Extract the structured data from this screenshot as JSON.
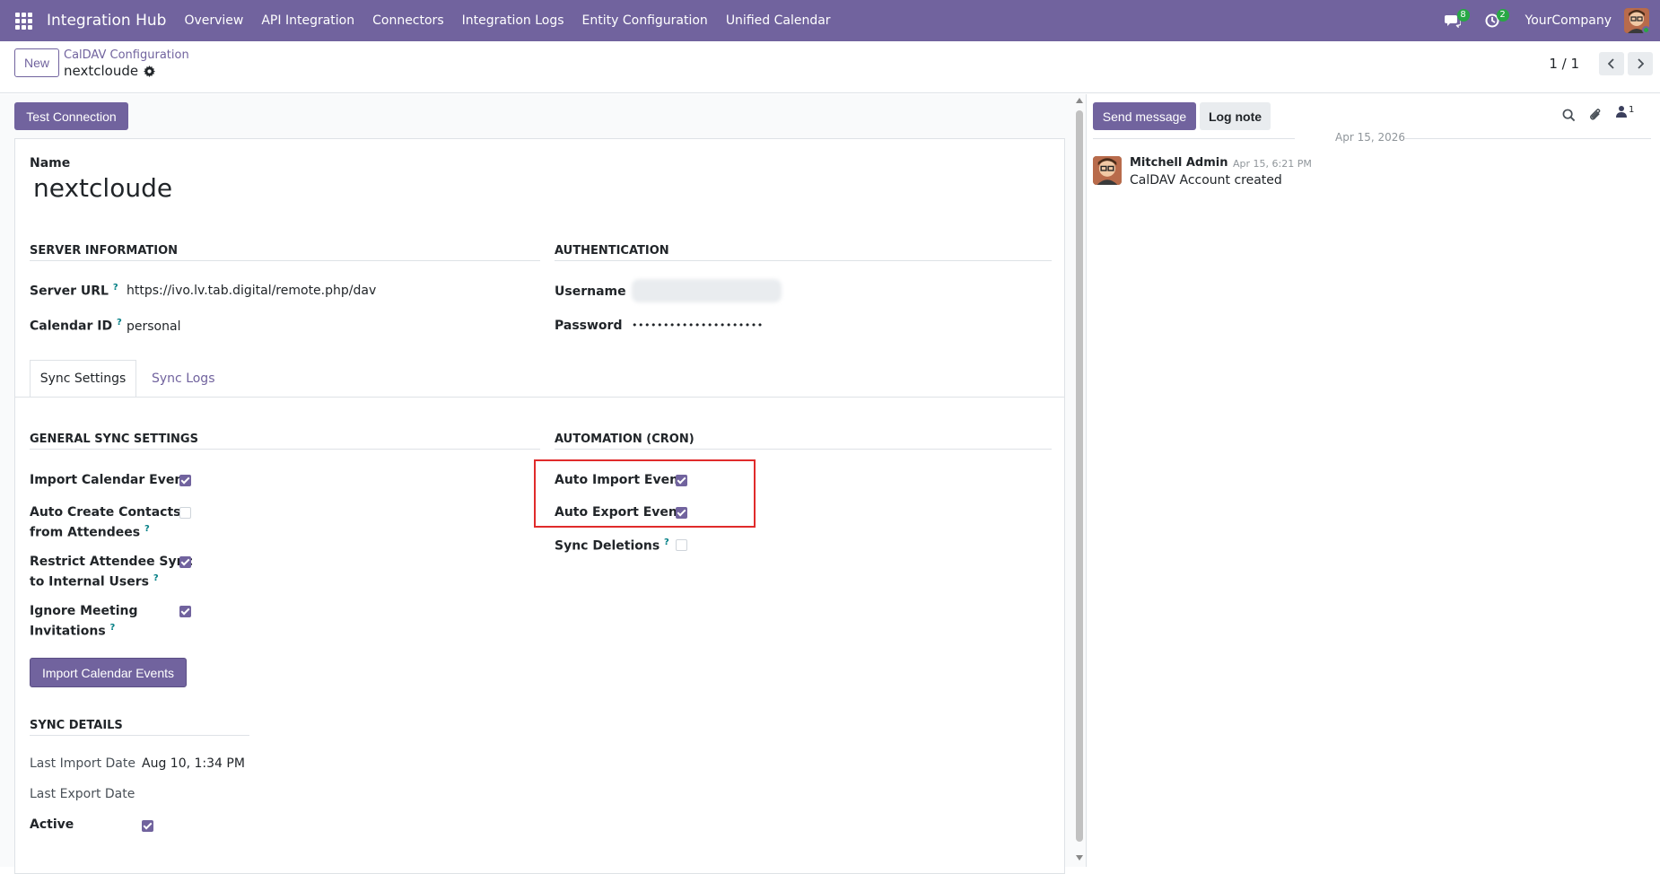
{
  "navbar": {
    "app_name": "Integration Hub",
    "menu": [
      "Overview",
      "API Integration",
      "Connectors",
      "Integration Logs",
      "Entity Configuration",
      "Unified Calendar"
    ],
    "messages_count": "8",
    "activities_count": "2",
    "company": "YourCompany"
  },
  "control_panel": {
    "new_label": "New",
    "breadcrumb_parent": "CalDAV Configuration",
    "breadcrumb_current": "nextcloude",
    "pager": "1 / 1"
  },
  "form": {
    "test_connection_label": "Test Connection",
    "name_label": "Name",
    "name_value": "nextcloude",
    "server_info_title": "SERVER INFORMATION",
    "server_url_label": "Server URL",
    "server_url_value": "https://ivo.lv.tab.digital/remote.php/dav",
    "calendar_id_label": "Calendar ID",
    "calendar_id_value": "personal",
    "auth_title": "AUTHENTICATION",
    "username_label": "Username",
    "password_label": "Password",
    "password_value": "•••••••••••••••••••••",
    "tabs": [
      "Sync Settings",
      "Sync Logs"
    ],
    "general_title": "GENERAL SYNC SETTINGS",
    "import_calendar_event_label": "Import Calendar Event",
    "import_calendar_event": true,
    "auto_create_contacts_label_1": "Auto Create Contacts",
    "auto_create_contacts_label_2": "from Attendees",
    "auto_create_contacts": false,
    "restrict_attendee_label_1": "Restrict Attendee Sync",
    "restrict_attendee_label_2": "to Internal Users",
    "restrict_attendee": true,
    "ignore_meeting_label_1": "Ignore Meeting",
    "ignore_meeting_label_2": "Invitations",
    "ignore_meeting": true,
    "import_button_label": "Import Calendar Events",
    "automation_title": "AUTOMATION (CRON)",
    "auto_import_label": "Auto Import Event",
    "auto_import": true,
    "auto_export_label": "Auto Export Event",
    "auto_export": true,
    "sync_deletions_label": "Sync Deletions",
    "sync_deletions": false,
    "sync_details_title": "SYNC DETAILS",
    "last_import_label": "Last Import Date",
    "last_import_value": "Aug 10, 1:34 PM",
    "last_export_label": "Last Export Date",
    "active_label": "Active",
    "active": true,
    "help_mark": "?"
  },
  "chatter": {
    "send_message_label": "Send message",
    "log_note_label": "Log note",
    "followers_count": "1",
    "date_separator": "Apr 15, 2026",
    "message_author": "Mitchell Admin",
    "message_time": "Apr 15, 6:21 PM",
    "message_body": "CalDAV Account created"
  },
  "colors": {
    "brand": "#71639e",
    "badge": "#28a745",
    "highlight": "#e02b2b",
    "help": "#017e84"
  }
}
